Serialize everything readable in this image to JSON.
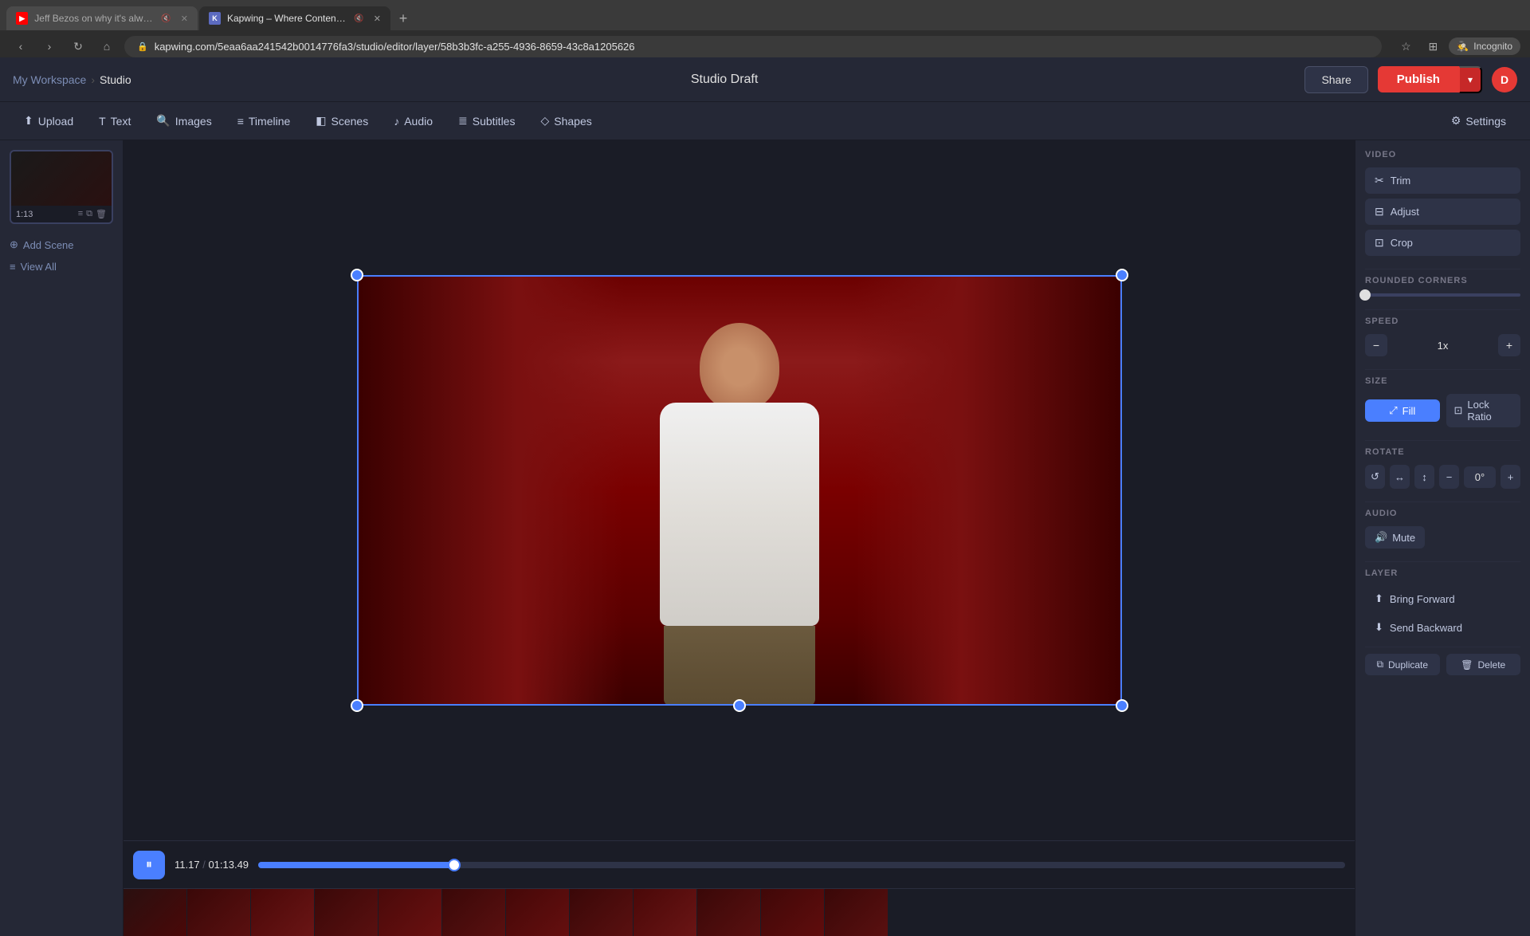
{
  "browser": {
    "tabs": [
      {
        "id": "yt",
        "label": "Jeff Bezos on why it's alway...",
        "favicon_type": "yt",
        "active": false,
        "muted": true
      },
      {
        "id": "kw",
        "label": "Kapwing – Where Content C...",
        "favicon_type": "kw",
        "active": true,
        "muted": true
      }
    ],
    "new_tab_label": "+",
    "address": "kapwing.com/5eaa6aa241542b0014776fa3/studio/editor/layer/58b3b3fc-a255-4936-8659-43c8a1205626",
    "incognito_label": "Incognito"
  },
  "toolbar": {
    "workspace_label": "My Workspace",
    "breadcrumb_sep": "›",
    "studio_label": "Studio",
    "title": "Studio Draft",
    "share_label": "Share",
    "publish_label": "Publish",
    "user_initial": "D"
  },
  "menu": {
    "items": [
      {
        "id": "upload",
        "icon": "⬆",
        "label": "Upload"
      },
      {
        "id": "text",
        "icon": "T",
        "label": "Text"
      },
      {
        "id": "images",
        "icon": "🔍",
        "label": "Images"
      },
      {
        "id": "timeline",
        "icon": "≡",
        "label": "Timeline"
      },
      {
        "id": "scenes",
        "icon": "◧",
        "label": "Scenes"
      },
      {
        "id": "audio",
        "icon": "♪",
        "label": "Audio"
      },
      {
        "id": "subtitles",
        "icon": "≣",
        "label": "Subtitles"
      },
      {
        "id": "shapes",
        "icon": "◇",
        "label": "Shapes"
      }
    ],
    "settings_label": "Settings"
  },
  "left_panel": {
    "scene_time": "1:13",
    "add_scene_label": "Add Scene",
    "view_all_label": "View All"
  },
  "timeline": {
    "current_time": "11.17",
    "divider": "/",
    "total_time": "01:13.49",
    "progress_pct": 18
  },
  "right_panel": {
    "video_section_title": "VIDEO",
    "trim_label": "Trim",
    "adjust_label": "Adjust",
    "crop_label": "Crop",
    "rounded_corners_title": "ROUNDED CORNERS",
    "speed_title": "SPEED",
    "speed_minus": "−",
    "speed_value": "1x",
    "speed_plus": "+",
    "size_title": "SIZE",
    "fill_label": "Fill",
    "lock_ratio_label": "Lock Ratio",
    "rotate_title": "ROTATE",
    "rotate_ccw": "↺",
    "rotate_flip_h": "↔",
    "rotate_flip_v": "↕",
    "rotate_minus": "−",
    "rotate_value": "0°",
    "rotate_plus": "+",
    "audio_title": "AUDIO",
    "mute_label": "Mute",
    "layer_title": "LAYER",
    "bring_forward_label": "Bring Forward",
    "send_backward_label": "Send Backward",
    "duplicate_label": "Duplicate",
    "delete_label": "Delete"
  }
}
